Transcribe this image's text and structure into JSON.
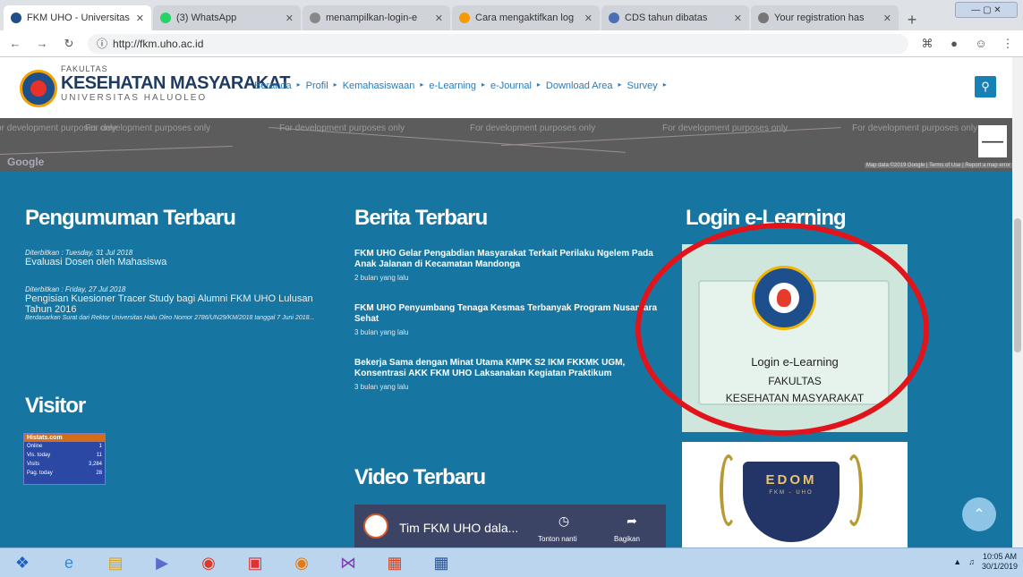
{
  "browser": {
    "tabs": [
      {
        "title": "FKM UHO - Universitas",
        "fav": "#1f4f8a",
        "active": true
      },
      {
        "title": "(3) WhatsApp",
        "fav": "#25d366",
        "active": false
      },
      {
        "title": "menampilkan-login-e",
        "fav": "#888888",
        "active": false
      },
      {
        "title": "Cara mengaktifkan log",
        "fav": "#f59a00",
        "active": false
      },
      {
        "title": "CDS tahun dibatas",
        "fav": "#4a6fb5",
        "active": false
      },
      {
        "title": "Your registration has",
        "fav": "#777777",
        "active": false
      }
    ],
    "url": "http://fkm.uho.ac.id",
    "window_controls": "— ▢ ✕"
  },
  "site": {
    "brand_small": "FAKULTAS",
    "brand_big": "KESEHATAN MASYARAKAT",
    "brand_sub": "UNIVERSITAS HALUOLEO",
    "nav": [
      "Beranda",
      "Profil",
      "Kemahasiswaan",
      "e-Learning",
      "e-Journal",
      "Download Area",
      "Survey"
    ],
    "nav_sep": "▸"
  },
  "map": {
    "watermark": "For development purposes only",
    "google": "Google",
    "attribution": "Map data ©2019 Google | Terms of Use | Report a map error",
    "zoom_out": "—"
  },
  "announcements": {
    "heading": "Pengumuman Terbaru",
    "items": [
      {
        "date": "Diterbitkan : Tuesday, 31 Jul 2018",
        "title": "Evaluasi Dosen oleh Mahasiswa",
        "note": ""
      },
      {
        "date": "Diterbitkan : Friday, 27 Jul 2018",
        "title": "Pengisian Kuesioner Tracer Study bagi Alumni FKM UHO Lulusan Tahun 2016",
        "note": "Berdasarkan Surat dari Rektor Universitas Halu Oleo Nomor 2786/UN29/KM/2018 tanggal 7 Juni 2018..."
      }
    ]
  },
  "visitor": {
    "heading": "Visitor",
    "widget_title": "Histats.com",
    "rows": [
      {
        "label": "Online",
        "value": "1"
      },
      {
        "label": "Vis. today",
        "value": "11"
      },
      {
        "label": "Visits",
        "value": "3,284"
      },
      {
        "label": "Pag. today",
        "value": "28"
      }
    ]
  },
  "news": {
    "heading": "Berita Terbaru",
    "items": [
      {
        "title": "FKM UHO Gelar Pengabdian Masyarakat Terkait Perilaku Ngelem Pada Anak Jalanan di Kecamatan Mandonga",
        "meta": "2 bulan yang lalu"
      },
      {
        "title": "FKM UHO Penyumbang Tenaga Kesmas Terbanyak Program Nusantara Sehat",
        "meta": "3 bulan yang lalu"
      },
      {
        "title": "Bekerja Sama dengan Minat Utama KMPK S2 IKM FKKMK UGM, Konsentrasi AKK FKM UHO Laksanakan Kegiatan Praktikum",
        "meta": "3 bulan yang lalu"
      }
    ]
  },
  "video": {
    "heading": "Video Terbaru",
    "title": "Tim FKM UHO dala...",
    "watch_later": "Tonton nanti",
    "share": "Bagikan"
  },
  "login": {
    "heading": "Login e-Learning",
    "line1": "Login e-Learning",
    "line2": "FAKULTAS",
    "line3": "KESEHATAN MASYARAKAT"
  },
  "edom": {
    "title": "EDOM",
    "sub": "FKM - UHO"
  },
  "taskbar": {
    "time": "10:05 AM",
    "date": "30/1/2019"
  },
  "colors": {
    "main_bg": "#1776a1",
    "highlight_ring": "#e2141b"
  }
}
